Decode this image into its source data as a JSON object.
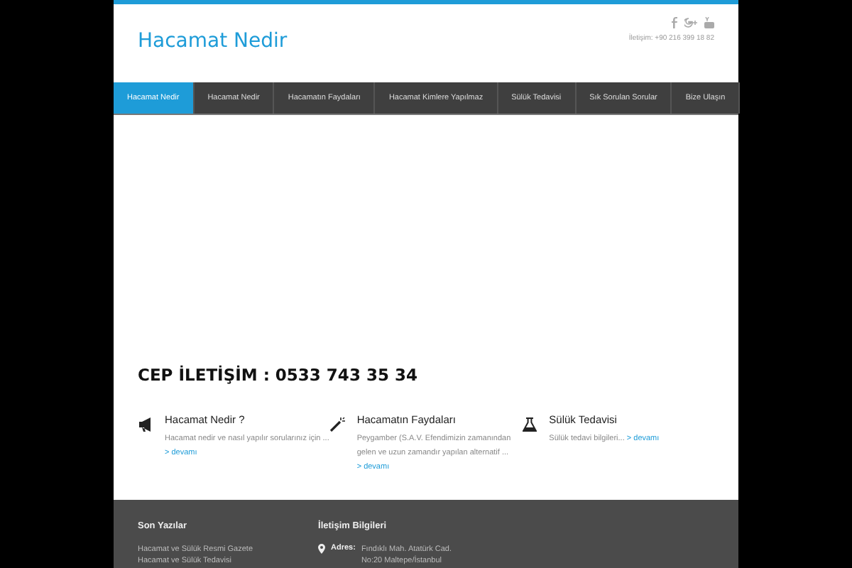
{
  "header": {
    "site_title": "Hacamat Nedir",
    "contact": "İletişim: +90 216 399 18 82"
  },
  "nav": [
    {
      "label": "Hacamat Nedir",
      "selected": true
    },
    {
      "label": "Hacamat Nedir",
      "selected": false
    },
    {
      "label": "Hacamatın Faydaları",
      "selected": false
    },
    {
      "label": "Hacamat Kimlere Yapılmaz",
      "selected": false
    },
    {
      "label": "Sülük Tedavisi",
      "selected": false
    },
    {
      "label": "Sık Sorulan Sorular",
      "selected": false
    },
    {
      "label": "Bize Ulaşın",
      "selected": false
    }
  ],
  "headline": "CEP İLETİŞİM : 0533 743 35 34",
  "features": [
    {
      "kind": "megaphone",
      "title": "Hacamat Nedir ?",
      "text": "Hacamat nedir ve nasıl yapılır sorularınız için ...",
      "link": "> devamı"
    },
    {
      "kind": "wand",
      "title": "Hacamatın Faydaları",
      "text": "Peygamber (S.A.V. Efendimizin zamanından gelen ve uzun zamandır yapılan alternatif ...",
      "link": "> devamı"
    },
    {
      "kind": "flask",
      "title": "Sülük Tedavisi",
      "text": "Sülük tedavi bilgileri...",
      "link": "> devamı"
    }
  ],
  "footer": {
    "recent_title": "Son Yazılar",
    "recent_posts": [
      "Hacamat ve Sülük Resmi Gazete",
      "Hacamat ve Sülük Tedavisi"
    ],
    "contact_title": "İletişim Bilgileri",
    "address_label": "Adres:",
    "address_lines": [
      "Fındıklı Mah. Atatürk Cad.",
      "No:20 Maltepe/İstanbul"
    ]
  }
}
